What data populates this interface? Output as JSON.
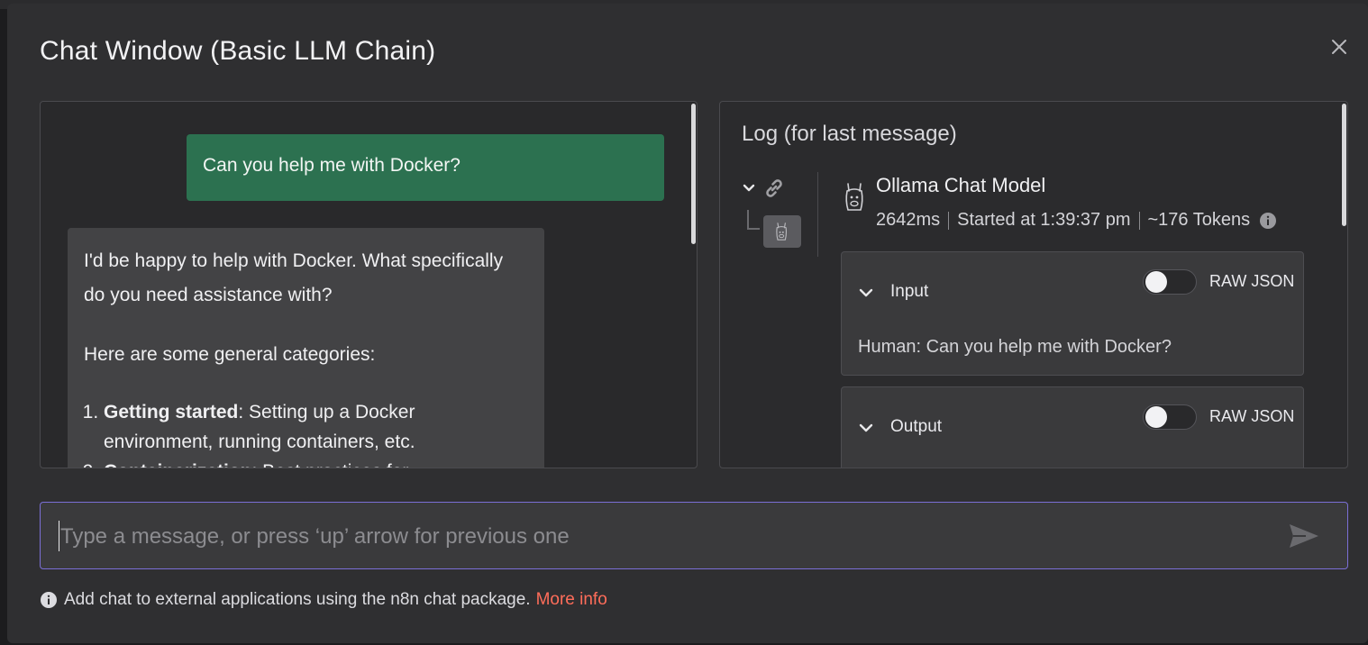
{
  "modal": {
    "title": "Chat Window (Basic LLM Chain)"
  },
  "chat": {
    "user_message": "Can you help me with Docker?",
    "bot_intro": "I'd be happy to help with Docker. What specifically do you need assistance with?",
    "bot_categories_intro": "Here are some general categories:",
    "bot_items": [
      {
        "bold": "Getting started",
        "text": ": Setting up a Docker environment, running containers, etc."
      },
      {
        "bold": "Containerization",
        "text": ": Best practices for"
      }
    ]
  },
  "log": {
    "title": "Log (for last message)",
    "model_name": "Ollama Chat Model",
    "duration": "2642ms",
    "started": "Started at 1:39:37 pm",
    "tokens": "~176 Tokens",
    "input_label": "Input",
    "output_label": "Output",
    "raw_json_label": "RAW JSON",
    "input_text": "Human: Can you help me with Docker?"
  },
  "input": {
    "placeholder": "Type a message, or press ‘up’ arrow for previous one"
  },
  "footer": {
    "text": "Add chat to external applications using the n8n chat package.",
    "link": "More info"
  },
  "colors": {
    "user_bubble": "#2c7150",
    "bot_bubble": "#434345",
    "accent_link": "#ff6d5a",
    "input_border": "#7b6fd6"
  },
  "icons": [
    "close-icon",
    "chevron-down-icon",
    "link-icon",
    "llama-icon",
    "info-icon",
    "send-icon"
  ]
}
